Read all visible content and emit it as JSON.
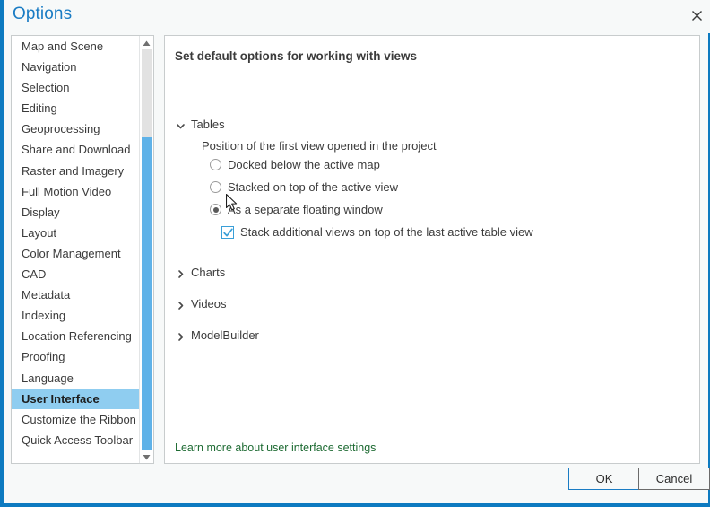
{
  "window": {
    "title": "Options",
    "close_icon": "close-icon",
    "accent_color": "#0d7ac0"
  },
  "sidebar": {
    "items": [
      {
        "label": "Map and Scene",
        "selected": false
      },
      {
        "label": "Navigation",
        "selected": false
      },
      {
        "label": "Selection",
        "selected": false
      },
      {
        "label": "Editing",
        "selected": false
      },
      {
        "label": "Geoprocessing",
        "selected": false
      },
      {
        "label": "Share and Download",
        "selected": false
      },
      {
        "label": "Raster and Imagery",
        "selected": false
      },
      {
        "label": "Full Motion Video",
        "selected": false
      },
      {
        "label": "Display",
        "selected": false
      },
      {
        "label": "Layout",
        "selected": false
      },
      {
        "label": "Color Management",
        "selected": false
      },
      {
        "label": "CAD",
        "selected": false
      },
      {
        "label": "Metadata",
        "selected": false
      },
      {
        "label": "Indexing",
        "selected": false
      },
      {
        "label": "Location Referencing",
        "selected": false
      },
      {
        "label": "Proofing",
        "selected": false
      },
      {
        "label": "Language",
        "selected": false
      },
      {
        "label": "User Interface",
        "selected": true
      },
      {
        "label": "Customize the Ribbon",
        "selected": false
      },
      {
        "label": "Quick Access Toolbar",
        "selected": false
      }
    ],
    "scrollbar": {
      "up_icon": "scroll-up-arrow-icon",
      "down_icon": "scroll-down-arrow-icon",
      "thumb_color": "#5fb2e8"
    },
    "selected_highlight_color": "#8fcdf0"
  },
  "main": {
    "heading": "Set default options for working with views",
    "groups": [
      {
        "label": "Tables",
        "expanded": true,
        "icon": "chevron-down-icon"
      },
      {
        "label": "Charts",
        "expanded": false,
        "icon": "chevron-right-icon"
      },
      {
        "label": "Videos",
        "expanded": false,
        "icon": "chevron-right-icon"
      },
      {
        "label": "ModelBuilder",
        "expanded": false,
        "icon": "chevron-right-icon"
      }
    ],
    "tables": {
      "position_label": "Position of the first view opened in the project",
      "radio_options": [
        {
          "label": "Docked below the active map",
          "checked": false
        },
        {
          "label": "Stacked on top of the active view",
          "checked": false
        },
        {
          "label": "As a separate floating window",
          "checked": true
        }
      ],
      "checkbox": {
        "label": "Stack additional views on top of the last active table view",
        "checked": true,
        "accent_color": "#3a9fd8"
      }
    },
    "learn_more_link": "Learn more about user interface settings",
    "link_color": "#1e6b33"
  },
  "footer": {
    "ok_label": "OK",
    "cancel_label": "Cancel"
  },
  "cursor": {
    "icon": "mouse-pointer-icon"
  }
}
